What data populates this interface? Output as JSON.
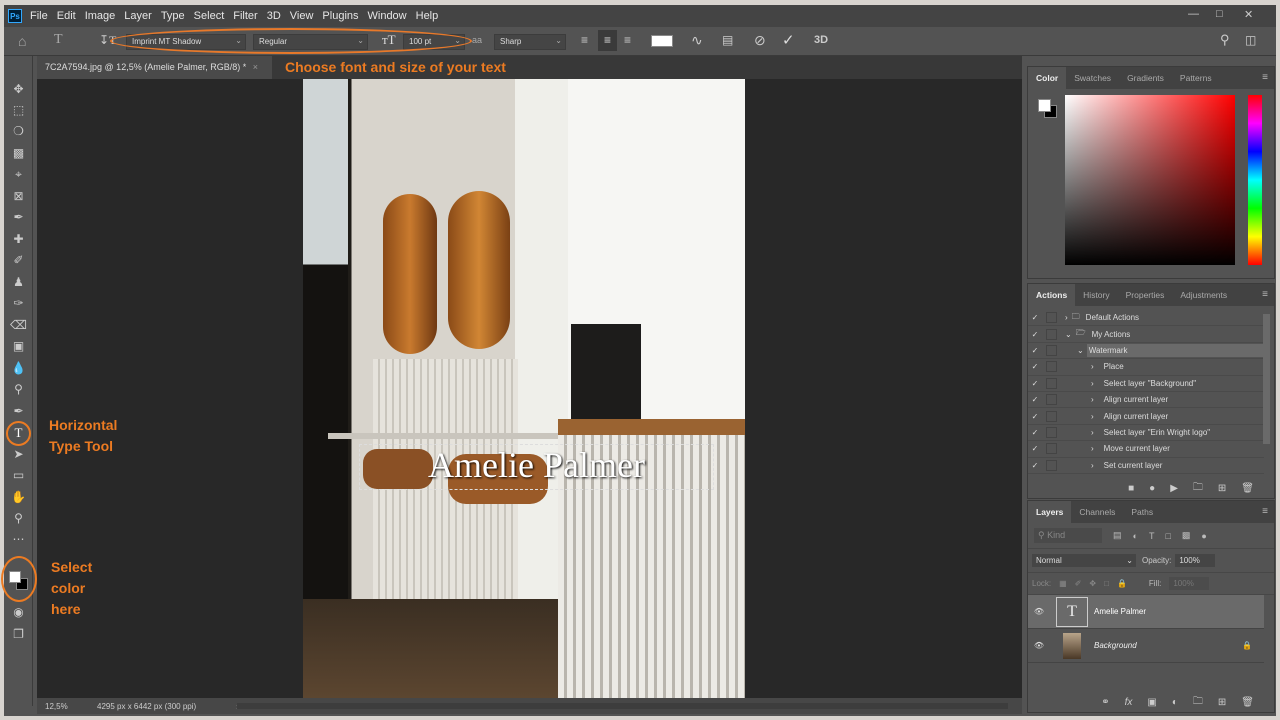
{
  "menu": [
    "File",
    "Edit",
    "Image",
    "Layer",
    "Type",
    "Select",
    "Filter",
    "3D",
    "View",
    "Plugins",
    "Window",
    "Help"
  ],
  "app_logo": "Ps",
  "options": {
    "font_family": "Imprint MT Shadow",
    "font_style": "Regular",
    "font_size": "100 pt",
    "antialias": "Sharp",
    "three_d": "3D"
  },
  "document": {
    "tab_title": "7C2A7594.jpg @ 12,5% (Amelie Palmer, RGB/8) *",
    "canvas_text": "Amelie Palmer"
  },
  "annotations": {
    "font_hint": "Choose font and size of your text",
    "type_tool": "Horizontal Type Tool",
    "color_hint": "Select color here",
    "accent": "#ec7b22"
  },
  "status": {
    "zoom": "12,5%",
    "doc_info": "4295 px x 6442 px (300 ppi)"
  },
  "color_panel": {
    "tabs": [
      "Color",
      "Swatches",
      "Gradients",
      "Patterns"
    ],
    "hue": "#ff0000"
  },
  "actions_panel": {
    "tabs": [
      "Actions",
      "History",
      "Properties",
      "Adjustments"
    ],
    "items": [
      {
        "label": "Default Actions",
        "level": 0,
        "type": "set"
      },
      {
        "label": "My Actions",
        "level": 0,
        "type": "set"
      },
      {
        "label": "Watermark",
        "level": 1,
        "type": "action"
      },
      {
        "label": "Place",
        "level": 2
      },
      {
        "label": "Select layer \"Background\"",
        "level": 2
      },
      {
        "label": "Align current layer",
        "level": 2
      },
      {
        "label": "Align current layer",
        "level": 2
      },
      {
        "label": "Select layer \"Erin Wright logo\"",
        "level": 2
      },
      {
        "label": "Move current layer",
        "level": 2
      },
      {
        "label": "Set current layer",
        "level": 2
      }
    ]
  },
  "layers_panel": {
    "tabs": [
      "Layers",
      "Channels",
      "Paths"
    ],
    "filter_placeholder": "Kind",
    "blend_mode": "Normal",
    "opacity_label": "Opacity:",
    "opacity": "100%",
    "lock_label": "Lock:",
    "fill_label": "Fill:",
    "fill": "100%",
    "layers": [
      {
        "name": "Amelie Palmer",
        "type": "text",
        "selected": true
      },
      {
        "name": "Background",
        "type": "image",
        "locked": true
      }
    ]
  }
}
